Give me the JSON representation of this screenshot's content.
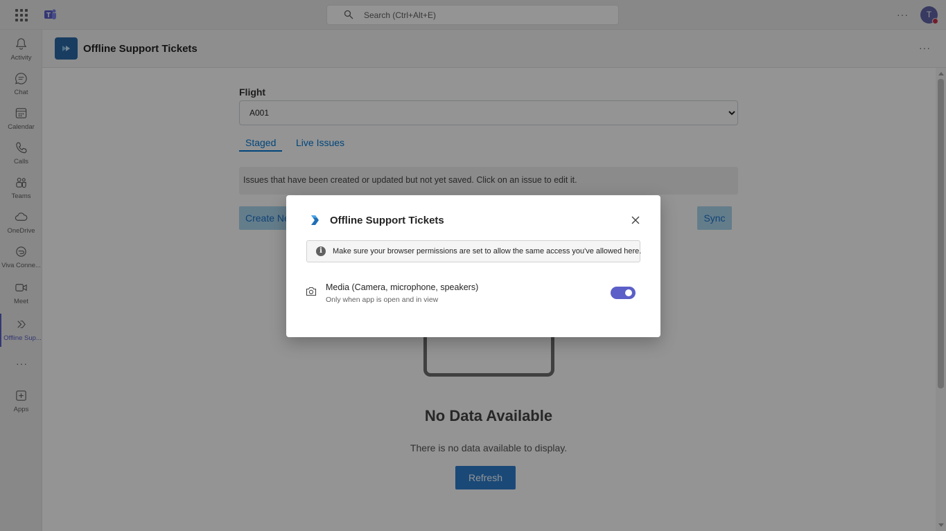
{
  "topbar": {
    "search_placeholder": "Search (Ctrl+Alt+E)",
    "avatar_initial": "T"
  },
  "rail": {
    "items": [
      {
        "label": "Activity",
        "icon": "bell-icon"
      },
      {
        "label": "Chat",
        "icon": "chat-icon"
      },
      {
        "label": "Calendar",
        "icon": "calendar-icon"
      },
      {
        "label": "Calls",
        "icon": "phone-icon"
      },
      {
        "label": "Teams",
        "icon": "teams-icon"
      },
      {
        "label": "OneDrive",
        "icon": "cloud-icon"
      },
      {
        "label": "Viva Conne...",
        "icon": "viva-icon"
      },
      {
        "label": "Meet",
        "icon": "video-icon"
      },
      {
        "label": "Offline Sup...",
        "icon": "app-icon"
      },
      {
        "label": "Apps",
        "icon": "add-icon"
      }
    ]
  },
  "app": {
    "title": "Offline Support Tickets"
  },
  "main": {
    "flight_label": "Flight",
    "flight_value": "A001",
    "tabs": [
      {
        "label": "Staged",
        "active": true
      },
      {
        "label": "Live Issues",
        "active": false
      }
    ],
    "info_text": "Issues that have been created or updated but not yet saved. Click on an issue to edit it.",
    "create_label": "Create New Issue",
    "sync_label": "Sync",
    "empty_title": "No Data Available",
    "empty_subtitle": "There is no data available to display.",
    "refresh_label": "Refresh"
  },
  "dialog": {
    "title": "Offline Support Tickets",
    "notice": "Make sure your browser permissions are set to allow the same access you've allowed here.",
    "permission_name": "Media (Camera, microphone, speakers)",
    "permission_desc": "Only when app is open and in view",
    "toggle_on": true
  },
  "colors": {
    "accent": "#5b5fc7",
    "link": "#0078d4",
    "app_icon": "#2b6aa7"
  }
}
